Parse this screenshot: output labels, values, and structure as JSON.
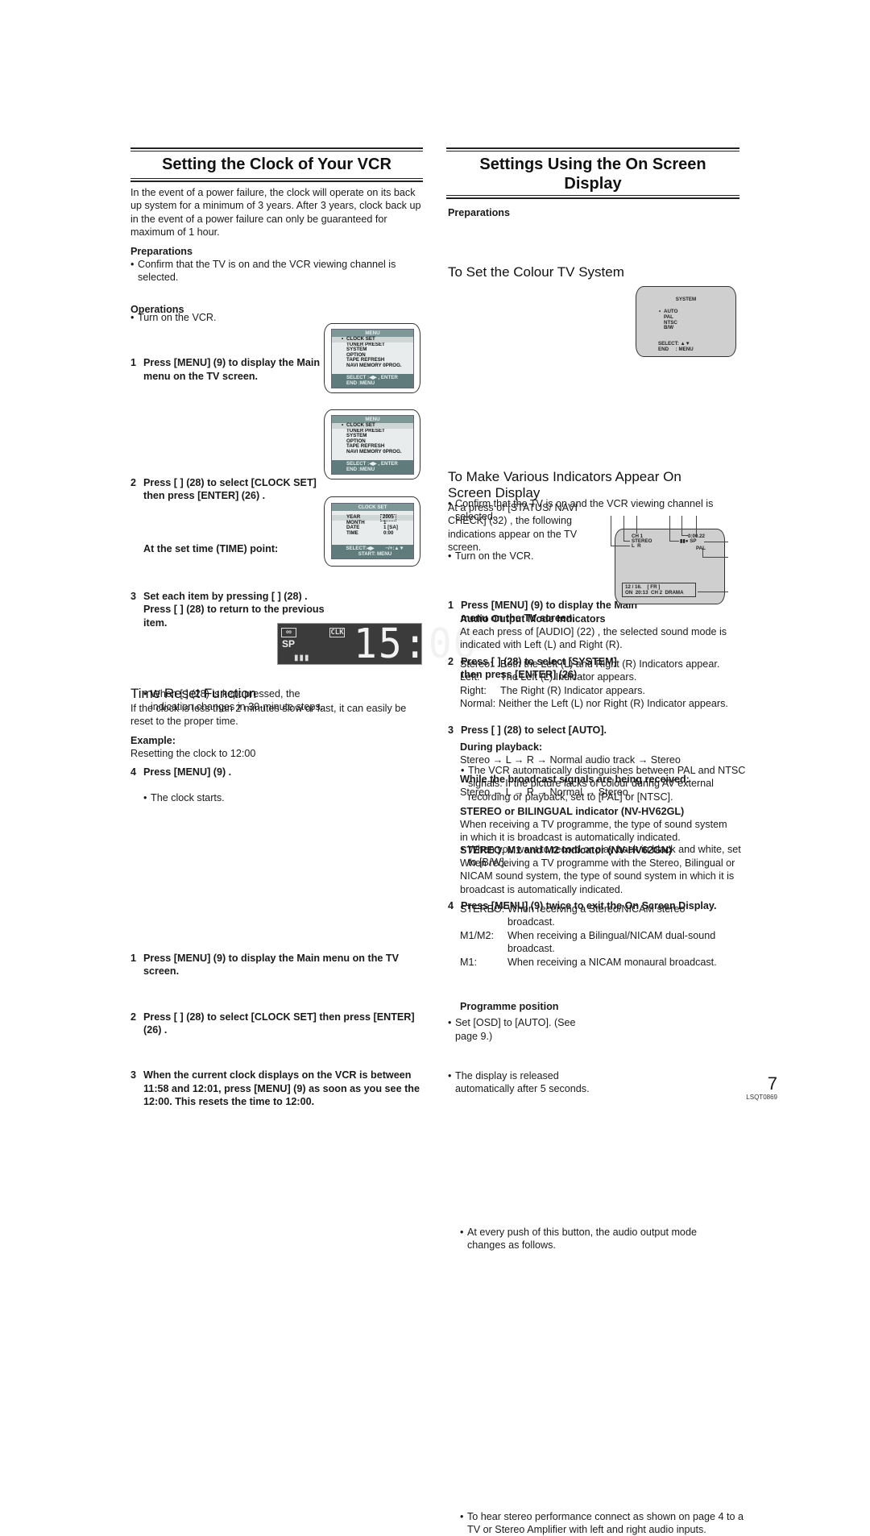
{
  "left": {
    "title": "Setting the Clock of Your VCR",
    "intro": "In the event of a power failure, the clock will operate on its back up system for a minimum of 3 years. After 3 years, clock back up in the event of a power failure can only be guaranteed for maximum of 1 hour.",
    "preparations": {
      "heading": "Preparations",
      "bullets": [
        "Confirm that the TV is on and the VCR viewing channel is selected.",
        "Turn on the VCR."
      ]
    },
    "operations": {
      "heading": "Operations",
      "steps": [
        {
          "n": "1",
          "text": "Press [MENU] (9)  to display the Main menu on the TV screen."
        },
        {
          "n": "2",
          "text": "Press [      ] (28)  to select [CLOCK SET] then press [ENTER] (26) ."
        },
        {
          "n": "3",
          "text": "Set each item by pressing [           ] (28) . Press [    ] (28)  to return to the previous item."
        },
        {
          "n": "4",
          "text": "Press [MENU] (9) ."
        }
      ],
      "step3_sub_heading": "At the set time (TIME) point:",
      "step3_bullet": "When [       ] (28)  is kept pressed, the indication changes in 30-minute steps.",
      "step4_bullet": "The clock starts."
    },
    "menu_screen": {
      "title": "MENU",
      "items": [
        "CLOCK SET",
        "TUNER PRESET",
        "SYSTEM",
        "OPTION",
        "TAPE REFRESH",
        "NAVI MEMORY 0PROG."
      ],
      "selected_marker": "•",
      "footer": [
        "SELECT :◀▶ , ENTER",
        "END      :MENU"
      ]
    },
    "clock_screen": {
      "title": "CLOCK SET",
      "rows": [
        {
          "label": "YEAR",
          "value": "2005"
        },
        {
          "label": "MONTH",
          "value": "1"
        },
        {
          "label": "DATE",
          "value": "1 [SA]"
        },
        {
          "label": "TIME",
          "value": "0:00"
        }
      ],
      "footer": [
        "SELECT:◀▶        −/+:▲▼",
        "START: MENU"
      ]
    },
    "vcr_display": {
      "clk_label": "CLK",
      "mode": "SP",
      "time": "15:00"
    },
    "time_reset": {
      "title": "Time Reset Function",
      "intro": "If the clock is less than 2 minutes slow or fast, it can easily be reset to the proper time.",
      "example_heading": "Example:",
      "example_text": "Resetting the clock to 12:00",
      "steps": [
        {
          "n": "1",
          "text": "Press [MENU] (9)  to display the Main menu on the TV screen."
        },
        {
          "n": "2",
          "text": "Press [       ] (28)  to select [CLOCK SET] then press [ENTER] (26) ."
        },
        {
          "n": "3",
          "text": "When the current clock displays on the VCR is between 11:58 and 12:01, press [MENU] (9)  as soon as you see the 12:00. This resets the time to 12:00."
        }
      ]
    }
  },
  "right": {
    "title_line1": "Settings Using the On Screen",
    "title_line2": "Display",
    "preparations": {
      "heading": "Preparations",
      "bullets": [
        "Confirm that the TV is on and the VCR viewing channel is selected.",
        "Turn on the VCR."
      ]
    },
    "colour_system": {
      "title": "To Set the Colour TV System",
      "steps": [
        {
          "n": "1",
          "text": "Press [MENU] (9)  to display the Main menu on the TV screen."
        },
        {
          "n": "2",
          "text": "Press [       ] (28)  to select [SYSTEM] then press [ENTER] (26) ."
        },
        {
          "n": "3",
          "text": "Press [       ] (28)  to select [AUTO]."
        },
        {
          "n": "4",
          "text": "Press [MENU] (9)  twice to exit the On Screen Display."
        }
      ],
      "step3_bullets": [
        "The VCR automatically distinguishes between PAL and NTSC signals. If the picture lacks of colour during AV external recording or playback, set to [PAL] or [NTSC].",
        "When you want to record or play back in black and white, set to [B/W]."
      ],
      "system_screen": {
        "title": "SYSTEM",
        "options": [
          "AUTO",
          "PAL",
          "NTSC",
          "B/W"
        ],
        "selected": "AUTO",
        "footer": [
          "SELECT: ▲▼",
          "END     : MENU"
        ]
      }
    },
    "indicators": {
      "title_line1": "To Make Various Indicators Appear On",
      "title_line2": "Screen Display",
      "intro": "At a press of [STATUS/ NAVI CHECK] (32) , the following indications appear on the TV screen.",
      "bullets": [
        "Set [OSD] to [AUTO]. (See page 9.)",
        "The display is released automatically after 5 seconds."
      ],
      "osd_screen": {
        "channel": "CH 1",
        "audio": "STEREO",
        "lr": "L  R",
        "counter": "0:00.22",
        "transport": "▮▮● SP",
        "system": "PAL",
        "info_line1": "12 / 16.    [ FR ]",
        "info_line2": "ON  20:13  CH 2  DRAMA"
      },
      "audio_output": {
        "heading": "Audio Output Mode Indicators",
        "intro": "At each press of [AUDIO] (22) , the selected sound mode is indicated with Left (L) and Right (R).",
        "modes": [
          {
            "k": "Stereo:",
            "v": "Both the Left (L) and Right (R) Indicators appear."
          },
          {
            "k": "Left:",
            "v": "The Left (L) Indicator appears."
          },
          {
            "k": "Right:",
            "v": "The Right (R) Indicator appears."
          },
          {
            "k": "Normal:",
            "v": "Neither the Left (L) nor Right (R) Indicator appears."
          }
        ],
        "bullet": "At every push of this button, the audio output mode changes as follows.",
        "playback_heading": "During playback:",
        "playback_seq": "Stereo → L → R → Normal audio track → Stereo",
        "broadcast_heading": "While the broadcast signals are being received:",
        "broadcast_seq": "Stereo → L → R → Normal → Stereo"
      },
      "stereo_gl": {
        "heading": "STEREO or BILINGUAL indicator (NV-HV62GL)",
        "text": "When receiving a TV programme, the type of sound system in which it is broadcast is automatically indicated."
      },
      "stereo_gn": {
        "heading": "STEREO, M1 and M2 Indicator (NV-HV62GN)",
        "text": "When receiving a TV programme with the Stereo, Bilingual or NICAM sound system, the type of sound system in which it is broadcast is automatically indicated."
      },
      "sound_types": [
        {
          "k": "STEREO:",
          "v": "When receiving a Stereo/NICAM stereo broadcast."
        },
        {
          "k": "M1/M2:",
          "v": "When receiving a Bilingual/NICAM dual-sound broadcast."
        },
        {
          "k": "M1:",
          "v": "When receiving a NICAM monaural broadcast."
        }
      ],
      "stereo_bullet": "To hear stereo performance connect as shown on page 4 to a TV or Stereo Amplifier with left and right audio inputs.",
      "programme_position": "Programme position"
    }
  },
  "footer": {
    "page_number": "7",
    "doc_code": "LSQT0869"
  }
}
